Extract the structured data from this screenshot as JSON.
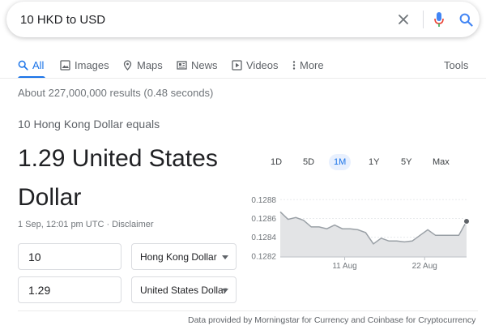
{
  "search": {
    "query": "10 HKD to USD"
  },
  "icons": {
    "clear": "close-icon",
    "mic": "mic-icon",
    "search": "search-icon"
  },
  "tabs": [
    {
      "label": "All",
      "icon": "search-icon",
      "active": true
    },
    {
      "label": "Images",
      "icon": "image-icon",
      "active": false
    },
    {
      "label": "Maps",
      "icon": "map-pin-icon",
      "active": false
    },
    {
      "label": "News",
      "icon": "newspaper-icon",
      "active": false
    },
    {
      "label": "Videos",
      "icon": "play-icon",
      "active": false
    },
    {
      "label": "More",
      "icon": "more-vert-icon",
      "active": false
    }
  ],
  "tools_label": "Tools",
  "result_stats": "About 227,000,000 results (0.48 seconds)",
  "converter": {
    "equals_text": "10 Hong Kong Dollar equals",
    "converted_text": "1.29 United States Dollar",
    "timestamp": "1 Sep, 12:01 pm UTC",
    "separator": " · ",
    "disclaimer": "Disclaimer",
    "from_amount": "10",
    "from_currency": "Hong Kong Dollar",
    "to_amount": "1.29",
    "to_currency": "United States Dollar"
  },
  "ranges": [
    {
      "label": "1D",
      "active": false
    },
    {
      "label": "5D",
      "active": false
    },
    {
      "label": "1M",
      "active": true
    },
    {
      "label": "1Y",
      "active": false
    },
    {
      "label": "5Y",
      "active": false
    },
    {
      "label": "Max",
      "active": false
    }
  ],
  "colors": {
    "accent": "#1a73e8",
    "line": "#9aa0a6",
    "area": "#e3e4e6",
    "endpoint": "#5f6368"
  },
  "chart_data": {
    "type": "area",
    "ylim": [
      0.12819,
      0.12888
    ],
    "yticks": [
      "0.1282",
      "0.1284",
      "0.1286",
      "0.1288"
    ],
    "ytick_values": [
      0.1282,
      0.1284,
      0.1286,
      0.1288
    ],
    "xticks": [
      "11 Aug",
      "22 Aug"
    ],
    "xtick_positions": [
      8.3,
      18.6
    ],
    "values": [
      0.12867,
      0.12859,
      0.12861,
      0.12858,
      0.12851,
      0.12851,
      0.12849,
      0.12853,
      0.12849,
      0.12849,
      0.12848,
      0.12845,
      0.12833,
      0.12839,
      0.12836,
      0.12836,
      0.12835,
      0.12836,
      0.12842,
      0.12848,
      0.12842,
      0.12842,
      0.12842,
      0.12842,
      0.12857
    ]
  },
  "attribution": "Data provided by Morningstar for Currency and Coinbase for Cryptocurrency"
}
